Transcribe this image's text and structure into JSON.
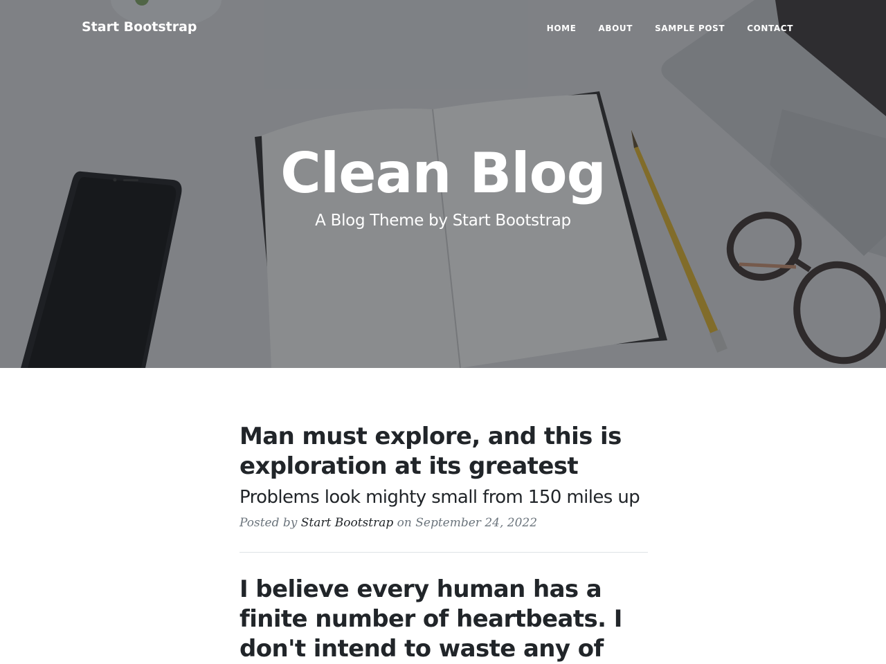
{
  "navbar": {
    "brand": "Start Bootstrap",
    "links": [
      "Home",
      "About",
      "Sample Post",
      "Contact"
    ]
  },
  "hero": {
    "title": "Clean Blog",
    "subtitle": "A Blog Theme by Start Bootstrap",
    "overlay_color": "#212529"
  },
  "posts": [
    {
      "title": "Man must explore, and this is exploration at its greatest",
      "subtitle": "Problems look mighty small from 150 miles up",
      "meta_prefix": "Posted by",
      "author": "Start Bootstrap",
      "meta_suffix": "on September 24, 2022"
    },
    {
      "title": "I believe every human has a finite number of heartbeats. I don't intend to waste any of"
    }
  ],
  "colors": {
    "text_dark": "#212529",
    "text_muted": "#6c757d",
    "divider": "#dee2e6"
  }
}
